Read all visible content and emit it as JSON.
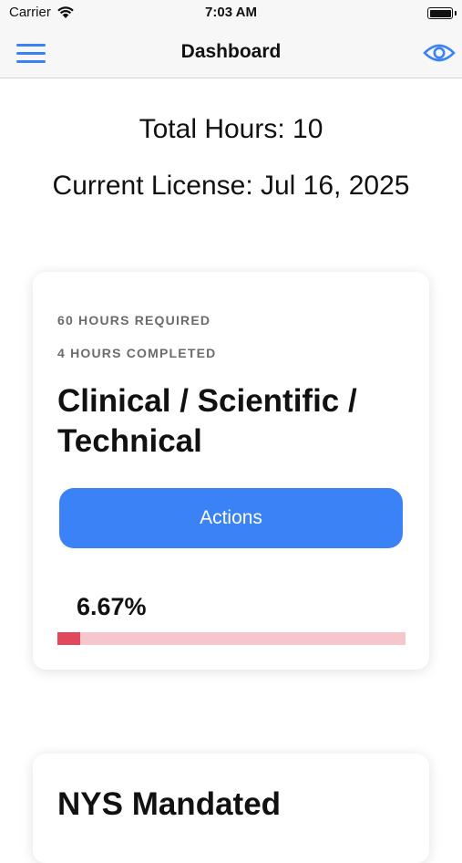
{
  "status_bar": {
    "carrier": "Carrier",
    "time": "7:03 AM",
    "wifi_icon": "wifi-icon",
    "battery_icon": "battery-icon"
  },
  "nav": {
    "title": "Dashboard",
    "menu_icon": "hamburger-menu-icon",
    "eye_icon": "eye-icon",
    "accent_color": "#3b82f6"
  },
  "summary": {
    "total_hours": "Total Hours: 10",
    "current_license": "Current License: Jul 16, 2025"
  },
  "cards": [
    {
      "required": "60 HOURS REQUIRED",
      "completed": "4 HOURS COMPLETED",
      "title": "Clinical / Scientific / Technical",
      "action_label": "Actions",
      "percent_label": "6.67%",
      "progress_fraction": 0.0667,
      "progress_color": "#e0485c",
      "progress_track_color": "#f7c6cc"
    },
    {
      "title": "NYS Mandated"
    }
  ]
}
